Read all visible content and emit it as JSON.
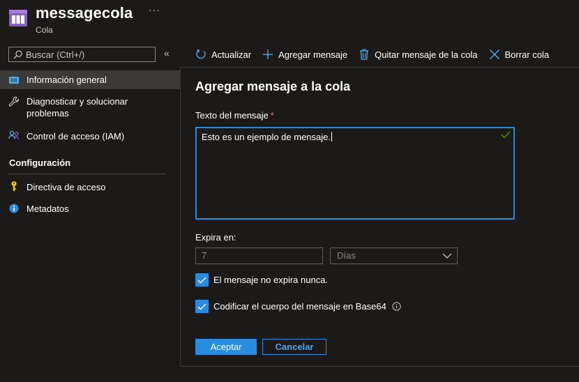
{
  "header": {
    "title": "messagecola",
    "subtitle": "Cola",
    "more_label": "···"
  },
  "sidebar": {
    "search_placeholder": "Buscar (Ctrl+/)",
    "collapse_label": "«",
    "items": [
      {
        "label": "Información general",
        "icon": "overview-icon",
        "selected": true
      },
      {
        "label": "Diagnosticar y solucionar problemas",
        "icon": "wrench-icon",
        "selected": false
      },
      {
        "label": "Control de acceso (IAM)",
        "icon": "people-icon",
        "selected": false
      }
    ],
    "section_heading": "Configuración",
    "config_items": [
      {
        "label": "Directiva de acceso",
        "icon": "key-icon"
      },
      {
        "label": "Metadatos",
        "icon": "info-icon"
      }
    ]
  },
  "toolbar": {
    "refresh_label": "Actualizar",
    "add_label": "Agregar mensaje",
    "dequeue_label": "Quitar mensaje de la cola",
    "clear_label": "Borrar cola"
  },
  "panel": {
    "title": "Agregar mensaje a la cola",
    "message_label": "Texto del mensaje",
    "required_mark": "*",
    "message_value": "Esto es un ejemplo de mensaje.",
    "expires_label": "Expira en:",
    "expires_value": "7",
    "unit_selected": "Días",
    "never_expires_label": "El mensaje no expira nunca.",
    "never_expires_checked": true,
    "base64_label": "Codificar el cuerpo del mensaje en Base64",
    "base64_checked": true,
    "ok_label": "Aceptar",
    "cancel_label": "Cancelar"
  },
  "colors": {
    "accent": "#2a8cde",
    "background": "#1b1a19",
    "selected_nav": "#3b3a39",
    "required": "#f1707b"
  }
}
